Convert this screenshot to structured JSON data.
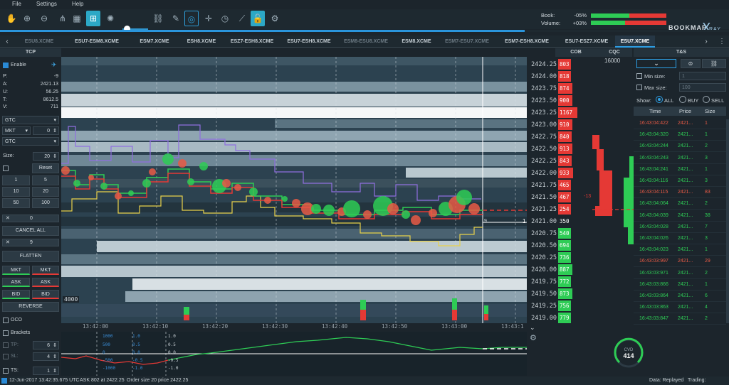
{
  "menu": [
    "File",
    "Settings",
    "Help"
  ],
  "toolbar": {
    "book_label": "Book:",
    "book_value": "-05%",
    "volume_label": "Volume:",
    "volume_value": "+03%",
    "logo": "BOOKMAP",
    "logo_x": "X",
    "logo_ray": "RAY",
    "replay_progress_pct": 72,
    "colors": {
      "accent": "#2ca8c6",
      "bid": "#2ecc55",
      "ask": "#e53935"
    }
  },
  "tabs": [
    {
      "label": "ESU8.XCME",
      "state": "dim"
    },
    {
      "label": "ESU7-ESM8.XCME",
      "state": "normal"
    },
    {
      "label": "ESM7.XCME",
      "state": "normal"
    },
    {
      "label": "ESH8.XCME",
      "state": "normal"
    },
    {
      "label": "ESZ7-ESH8.XCME",
      "state": "normal"
    },
    {
      "label": "ESU7-ESH8.XCME",
      "state": "normal"
    },
    {
      "label": "ESM8-ESU8.XCME",
      "state": "dim"
    },
    {
      "label": "ESM8.XCME",
      "state": "normal"
    },
    {
      "label": "ESM7-ESU7.XCME",
      "state": "dim"
    },
    {
      "label": "ESM7-ESH8.XCME",
      "state": "normal"
    },
    {
      "label": "ESU7-ESZ7.XCME",
      "state": "normal"
    },
    {
      "label": "ESU7.XCME",
      "state": "active"
    }
  ],
  "tab_nav": {
    "prev": "‹",
    "next": "›",
    "menu": "⋮"
  },
  "headers": {
    "tcp": "TCP",
    "cob": "COB",
    "cqc": "CQC",
    "ts": "T&S"
  },
  "tcp": {
    "enable_label": "Enable",
    "stats": [
      {
        "k": "P:",
        "v": "-9"
      },
      {
        "k": "A:",
        "v": "2421.13"
      },
      {
        "k": "U:",
        "v": "56.25"
      },
      {
        "k": "T:",
        "v": "8612.5"
      },
      {
        "k": "V:",
        "v": "711"
      }
    ],
    "tif1": "GTC",
    "order_type": "MKT",
    "qty": "0",
    "tif2": "GTC",
    "size_label": "Size:",
    "size_value": "20",
    "reset_label": "Reset",
    "size_buttons": [
      "1",
      "5",
      "10",
      "20",
      "50",
      "100"
    ],
    "cancel_count": "0",
    "cancel_all_label": "CANCEL ALL",
    "pos_count": "9",
    "flatten_label": "FLATTEN",
    "mkt_buy": "MKT",
    "mkt_sell": "MKT",
    "ask_buy": "ASK",
    "ask_sell": "ASK",
    "bid_buy": "BID",
    "bid_sell": "BID",
    "reverse_label": "REVERSE",
    "oco_label": "OCO",
    "brackets_label": "Brackets",
    "tp_label": "TP:",
    "tp_value": "6",
    "sl_label": "SL:",
    "sl_value": "4",
    "ts_label": "TS:",
    "ts_value": "1"
  },
  "chart": {
    "time_ticks": [
      "13:42:00",
      "13:42:10",
      "13:42:20",
      "13:42:30",
      "13:42:40",
      "13:42:50",
      "13:43:00",
      "13:43:1"
    ],
    "level_label": "4000",
    "last_trade_marker": "1",
    "position_marker": "9",
    "sub_left_labels": [
      "1000",
      "500",
      "0",
      "-500",
      "-1000"
    ],
    "sub_mid_labels": [
      "1.0",
      "0.5",
      "0.0",
      "-0.5",
      "-1.0"
    ],
    "sub_right_labels": [
      "1.0",
      "0.5",
      "0.0",
      "-0.5",
      "-1.0"
    ]
  },
  "ladder": {
    "cqc_value": "16000",
    "rows": [
      {
        "price": "2424.25",
        "size": "803",
        "side": "ask",
        "pct": 0.62
      },
      {
        "price": "2424.00",
        "size": "818",
        "side": "ask",
        "pct": 0.66
      },
      {
        "price": "2423.75",
        "size": "874",
        "side": "ask",
        "pct": 0.7
      },
      {
        "price": "2423.50",
        "size": "900",
        "side": "ask",
        "pct": 0.72
      },
      {
        "price": "2423.25",
        "size": "1167",
        "side": "ask",
        "pct": 0.98
      },
      {
        "price": "2423.00",
        "size": "910",
        "side": "ask",
        "pct": 0.73
      },
      {
        "price": "2422.75",
        "size": "840",
        "side": "ask",
        "pct": 0.67
      },
      {
        "price": "2422.50",
        "size": "913",
        "side": "ask",
        "pct": 0.73
      },
      {
        "price": "2422.25",
        "size": "843",
        "side": "ask",
        "pct": 0.67
      },
      {
        "price": "2422.00",
        "size": "933",
        "side": "ask",
        "pct": 0.75
      },
      {
        "price": "2421.75",
        "size": "465",
        "side": "ask",
        "pct": 0.37
      },
      {
        "price": "2421.50",
        "size": "467",
        "side": "ask",
        "pct": 0.37
      },
      {
        "price": "2421.25",
        "size": "254",
        "side": "ask",
        "pct": 0.2
      },
      {
        "price": "2421.00",
        "size": "350",
        "side": "last",
        "pct": 0.0
      },
      {
        "price": "2420.75",
        "size": "540",
        "side": "bid",
        "pct": 0.43
      },
      {
        "price": "2420.50",
        "size": "694",
        "side": "bid",
        "pct": 0.55
      },
      {
        "price": "2420.25",
        "size": "736",
        "side": "bid",
        "pct": 0.59
      },
      {
        "price": "2420.00",
        "size": "887",
        "side": "bid",
        "pct": 0.71
      },
      {
        "price": "2419.75",
        "size": "772",
        "side": "bid",
        "pct": 0.62
      },
      {
        "price": "2419.50",
        "size": "873",
        "side": "bid",
        "pct": 0.7
      },
      {
        "price": "2419.25",
        "size": "756",
        "side": "bid",
        "pct": 0.6
      },
      {
        "price": "2419.00",
        "size": "779",
        "side": "bid",
        "pct": 0.62
      }
    ],
    "cqc_marker": "-13",
    "collapse_icon": "⌄"
  },
  "ts_panel": {
    "min_size_label": "Min size:",
    "min_size_value": "1",
    "max_size_label": "Max size:",
    "max_size_value": "100",
    "show_label": "Show:",
    "radio_all": "ALL",
    "radio_buy": "BUY",
    "radio_sell": "SELL",
    "col_time": "Time",
    "col_price": "Price",
    "col_size": "Size",
    "rows": [
      {
        "time": "16:43:04:422",
        "price": "2421...",
        "size": "1",
        "side": "sell"
      },
      {
        "time": "16:43:04:320",
        "price": "2421...",
        "size": "1",
        "side": "buy"
      },
      {
        "time": "16:43:04:244",
        "price": "2421...",
        "size": "2",
        "side": "buy"
      },
      {
        "time": "16:43:04:243",
        "price": "2421...",
        "size": "3",
        "side": "buy"
      },
      {
        "time": "16:43:04:241",
        "price": "2421...",
        "size": "1",
        "side": "buy"
      },
      {
        "time": "16:43:04:116",
        "price": "2421...",
        "size": "3",
        "side": "buy"
      },
      {
        "time": "16:43:04:115",
        "price": "2421...",
        "size": "83",
        "side": "sell"
      },
      {
        "time": "16:43:04:064",
        "price": "2421...",
        "size": "2",
        "side": "buy"
      },
      {
        "time": "16:43:04:039",
        "price": "2421...",
        "size": "38",
        "side": "buy"
      },
      {
        "time": "16:43:04:028",
        "price": "2421...",
        "size": "7",
        "side": "buy"
      },
      {
        "time": "16:43:04:026",
        "price": "2421...",
        "size": "3",
        "side": "buy"
      },
      {
        "time": "16:43:04:023",
        "price": "2421...",
        "size": "1",
        "side": "buy"
      },
      {
        "time": "16:43:03:997",
        "price": "2421...",
        "size": "29",
        "side": "sell"
      },
      {
        "time": "16:43:03:971",
        "price": "2421...",
        "size": "2",
        "side": "buy"
      },
      {
        "time": "16:43:03:866",
        "price": "2421...",
        "size": "1",
        "side": "buy"
      },
      {
        "time": "16:43:03:864",
        "price": "2421...",
        "size": "6",
        "side": "buy"
      },
      {
        "time": "16:43:03:863",
        "price": "2421...",
        "size": "4",
        "side": "buy"
      },
      {
        "time": "16:43:03:847",
        "price": "2421...",
        "size": "2",
        "side": "buy"
      }
    ]
  },
  "cvd": {
    "label": "CVD",
    "value": "414"
  },
  "status": {
    "datetime": "12-Jun-2017 13:42:35.675 UTC",
    "ask_info": "ASK 802 at 2422.25",
    "order_info": "Order size 20 price 2422.25",
    "data_mode": "Data: Replayed",
    "trading_mode": "Trading: Simulated"
  }
}
